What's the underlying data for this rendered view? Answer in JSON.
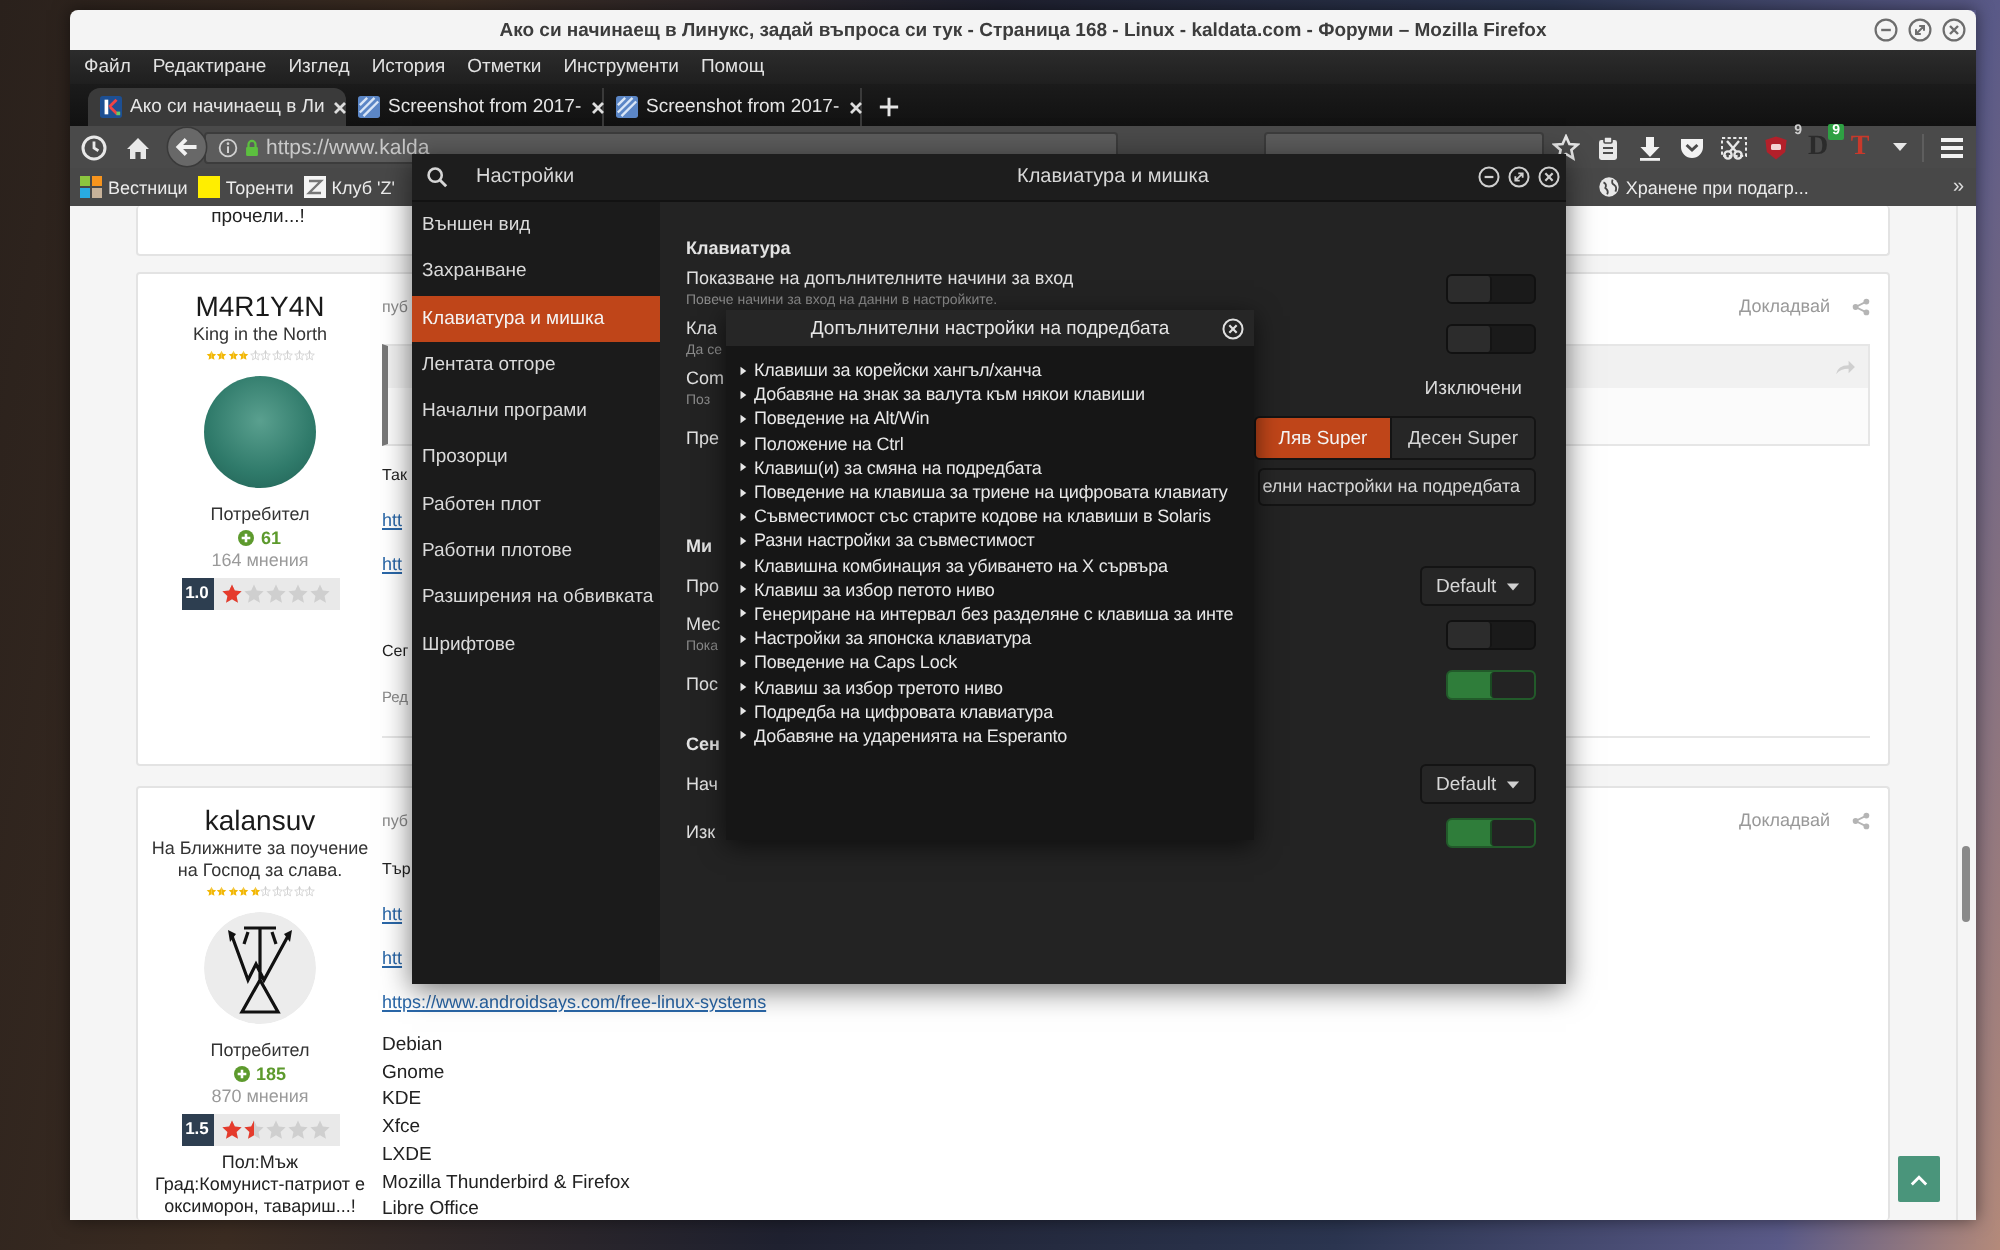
{
  "browser": {
    "title": "Ако си начинаещ в Линукс, задай въпроса си тук - Страница 168 - Linux - kaldata.com - Форуми – Mozilla Firefox",
    "menu": [
      "Файл",
      "Редактиране",
      "Изглед",
      "История",
      "Отметки",
      "Инструменти",
      "Помощ"
    ],
    "tabs": [
      {
        "label": "Ако си начинаещ в Ли",
        "kind": "site",
        "selected": true
      },
      {
        "label": "Screenshot from 2017-",
        "kind": "image",
        "selected": false
      },
      {
        "label": "Screenshot from 2017-",
        "kind": "image",
        "selected": false
      }
    ],
    "url": "https://www.kalda",
    "extensions": [
      {
        "kind": "shield",
        "badge": "9"
      },
      {
        "kind": "letter",
        "text": "D",
        "badge": "9",
        "color": "#2b2b2b"
      },
      {
        "kind": "letter",
        "text": "T",
        "color": "#c8392b"
      }
    ],
    "bookmarks": [
      {
        "label": "Вестници",
        "kind": "tiles"
      },
      {
        "label": "Торенти",
        "kind": "square"
      },
      {
        "label": "Клуб 'Z'",
        "kind": "page"
      }
    ],
    "bookmarks_right": [
      {
        "label": "Хранене при подагр...",
        "kind": "globe"
      }
    ],
    "bookmarks_overflow": "»"
  },
  "page": {
    "top_card": "прочели...!",
    "posts": [
      {
        "author": "M4R1Y4N",
        "title": "King in the North",
        "rank": {
          "stars": 4
        },
        "avatar": {
          "kind": "portrait"
        },
        "group": "Потребител",
        "reputation": "61",
        "posts_count": "164 мнения",
        "rating": {
          "score": "1.0",
          "stars": 1
        },
        "date": "пуб",
        "report": "Докладвай",
        "body": [
          {
            "kind": "quote"
          },
          {
            "kind": "text",
            "text": "Так"
          },
          {
            "kind": "link",
            "text": "htt"
          },
          {
            "kind": "link",
            "text": "htt"
          },
          {
            "kind": "text",
            "text": "Сег"
          },
          {
            "kind": "note",
            "text": "Ред"
          },
          {
            "kind": "rule"
          }
        ]
      },
      {
        "author": "kalansuv",
        "title": "На Ближните за поучение на Господ за слава.",
        "rank": {
          "stars": 5
        },
        "avatar": {
          "kind": "emblem"
        },
        "group": "Потребител",
        "reputation": "185",
        "posts_count": "870 мнения",
        "rating": {
          "score": "1.5",
          "stars": 1.5
        },
        "profile_lines": [
          "Пол:Мъж",
          "Град:Комунист-патриот е оксиморон, тавариш...!"
        ],
        "date": "пуб",
        "report": "Докладвай",
        "body": [
          {
            "kind": "text",
            "text": "Тър"
          },
          {
            "kind": "link",
            "text": "htt"
          },
          {
            "kind": "link",
            "text": "htt"
          },
          {
            "kind": "link",
            "text": "https://www.androidsays.com/free-linux-systems"
          },
          {
            "kind": "line",
            "text": "Debian"
          },
          {
            "kind": "line",
            "text": "Gnome"
          },
          {
            "kind": "line",
            "text": "KDE"
          },
          {
            "kind": "line",
            "text": "Xfce"
          },
          {
            "kind": "line",
            "text": "LXDE"
          },
          {
            "kind": "line",
            "text": "Mozilla Thunderbird & Firefox"
          },
          {
            "kind": "line",
            "text": "Libre Office"
          }
        ]
      }
    ]
  },
  "settings": {
    "app_title": "Настройки",
    "title": "Клавиатура и мишка",
    "sidebar": [
      {
        "label": "Външен вид",
        "selected": false
      },
      {
        "label": "Захранване",
        "selected": false
      },
      {
        "label": "Клавиатура и мишка",
        "selected": true
      },
      {
        "label": "Лентата отгоре",
        "selected": false
      },
      {
        "label": "Начални програми",
        "selected": false
      },
      {
        "label": "Прозорци",
        "selected": false
      },
      {
        "label": "Работен плот",
        "selected": false
      },
      {
        "label": "Работни плотове",
        "selected": false
      },
      {
        "label": "Разширения на обвивката",
        "selected": false
      },
      {
        "label": "Шрифтове",
        "selected": false
      }
    ],
    "sections": [
      {
        "heading": "Клавиатура",
        "rows": [
          {
            "kind": "switch",
            "label": "Показване на допълнителните начини за вход",
            "description": "Повече начини за вход на данни в настройките.",
            "on": false
          },
          {
            "kind": "switch",
            "label": "Кла",
            "description": "Да се",
            "on": false
          },
          {
            "kind": "value",
            "label": "Com",
            "description": "Поз",
            "value": "Изключени"
          },
          {
            "kind": "segmented",
            "label": "Пре",
            "options": [
              {
                "label": "Ляв Super",
                "selected": true
              },
              {
                "label": "Десен Super",
                "selected": false
              }
            ]
          },
          {
            "kind": "button",
            "button": "елни настройки на подредбата"
          }
        ]
      },
      {
        "heading": "Ми",
        "rows": [
          {
            "kind": "dropdown",
            "label": "Про",
            "value": "Default"
          },
          {
            "kind": "switch",
            "label": "Мес",
            "description": "Пока",
            "on": false
          },
          {
            "kind": "switch",
            "label": "Пос",
            "on": true
          }
        ]
      },
      {
        "heading": "Сен",
        "rows": [
          {
            "kind": "dropdown",
            "label": "Нач",
            "value": "Default"
          },
          {
            "kind": "switch",
            "label": "Изк",
            "on": true
          }
        ]
      }
    ]
  },
  "layout_dialog": {
    "title": "Допълнителни настройки на подредбата",
    "items": [
      {
        "label": "Клавиши за корейски хангъл/ханча",
        "expanded": false
      },
      {
        "label": "Добавяне на знак за валута към някои клавиши",
        "expanded": false
      },
      {
        "label": "Поведение на Alt/Win",
        "expanded": false
      },
      {
        "label": "Положение на Ctrl",
        "expanded": false
      },
      {
        "label": "Клавиш(и) за смяна на подредбата",
        "expanded": false
      },
      {
        "label": "Поведение на клавиша за триене на цифровата клавиату",
        "expanded": false
      },
      {
        "label": "Съвместимост със старите кодове на клавиши в Solaris",
        "expanded": false
      },
      {
        "label": "Разни настройки за съвместимост",
        "expanded": false
      },
      {
        "label": "Клавишна комбинация за убиването на X сървъра",
        "expanded": false
      },
      {
        "label": "Клавиш за избор петото ниво",
        "expanded": false
      },
      {
        "label": "Генериране на интервал без разделяне с клавиша за инте",
        "expanded": false
      },
      {
        "label": "Настройки за японска клавиатура",
        "expanded": false
      },
      {
        "label": "Поведение на Caps Lock",
        "expanded": false
      },
      {
        "label": "Клавиш за избор третото ниво",
        "expanded": false
      },
      {
        "label": "Подредба на цифровата клавиатура",
        "expanded": false
      },
      {
        "label": "Добавяне на ударенията на Esperanto",
        "expanded": false
      }
    ]
  }
}
